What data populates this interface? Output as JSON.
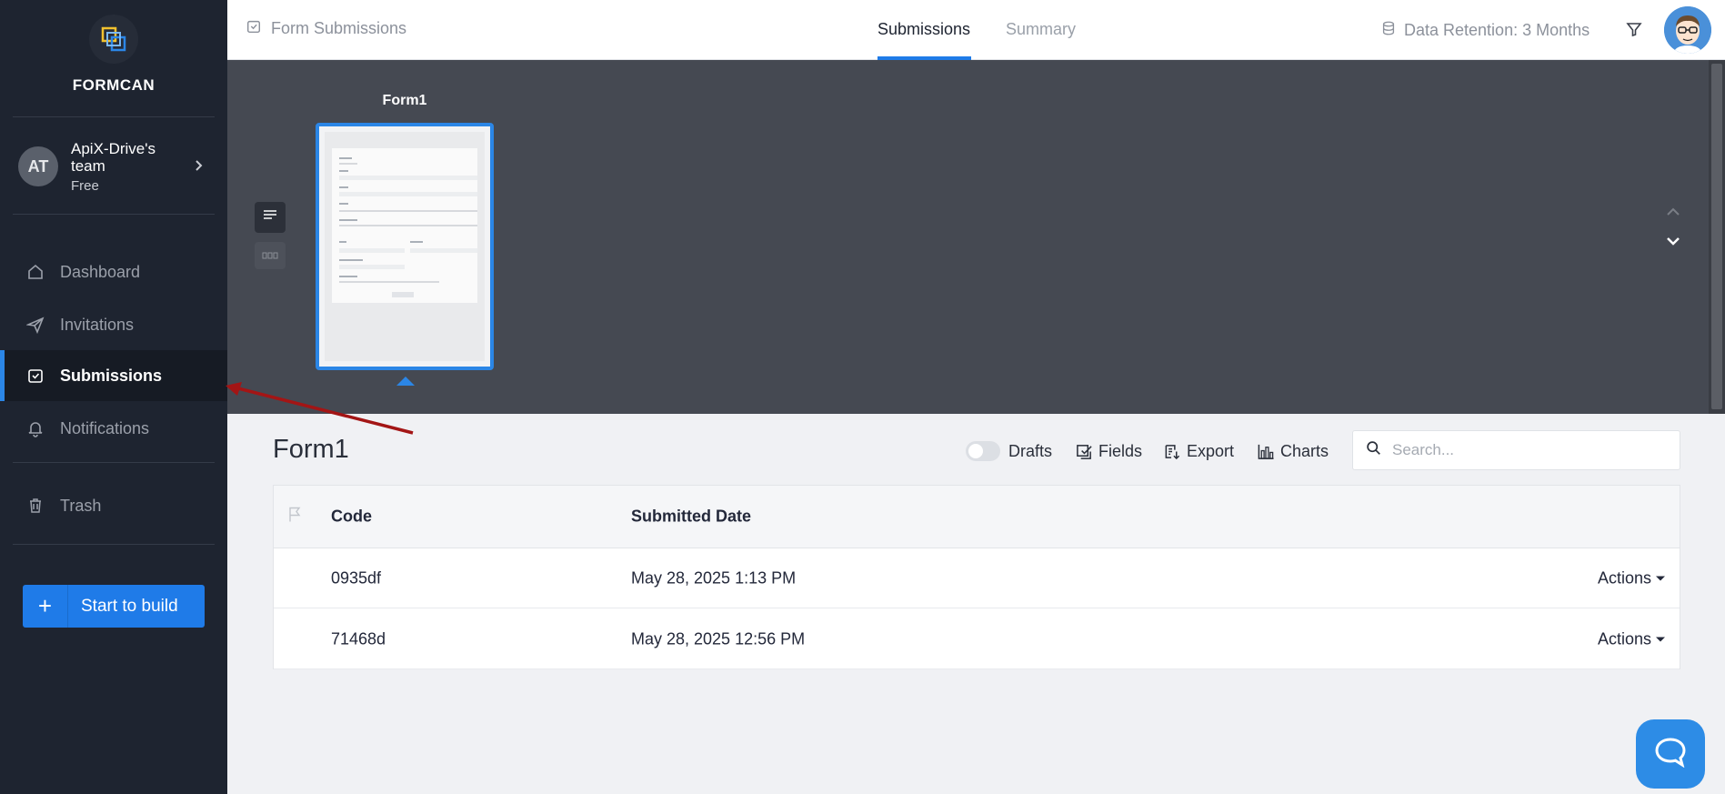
{
  "app": {
    "brand": "FORMCAN"
  },
  "team": {
    "initials": "AT",
    "name": "ApiX-Drive's team",
    "plan": "Free"
  },
  "sidebar": {
    "items": [
      {
        "label": "Dashboard",
        "icon": "home-icon"
      },
      {
        "label": "Invitations",
        "icon": "paper-plane-icon"
      },
      {
        "label": "Submissions",
        "icon": "inbox-check-icon",
        "active": true
      },
      {
        "label": "Notifications",
        "icon": "bell-icon"
      },
      {
        "label": "Trash",
        "icon": "trash-icon"
      }
    ],
    "build_button": "Start to build"
  },
  "topbar": {
    "breadcrumb": "Form Submissions",
    "tabs": [
      {
        "label": "Submissions",
        "active": true
      },
      {
        "label": "Summary",
        "active": false
      }
    ],
    "retention": "Data Retention: 3 Months"
  },
  "preview": {
    "form_title": "Form1"
  },
  "main": {
    "title": "Form1",
    "toolbar": {
      "drafts": "Drafts",
      "fields": "Fields",
      "export": "Export",
      "charts": "Charts"
    },
    "search": {
      "placeholder": "Search..."
    },
    "table": {
      "columns": [
        "Code",
        "Submitted Date"
      ],
      "rows": [
        {
          "code": "0935df",
          "date": "May 28, 2025 1:13 PM",
          "actions": "Actions"
        },
        {
          "code": "71468d",
          "date": "May 28, 2025 12:56 PM",
          "actions": "Actions"
        }
      ]
    }
  },
  "colors": {
    "accent": "#1f7be8",
    "sidebar": "#1e2430",
    "preview_bg": "#454952",
    "annotation_arrow": "#a31515"
  }
}
